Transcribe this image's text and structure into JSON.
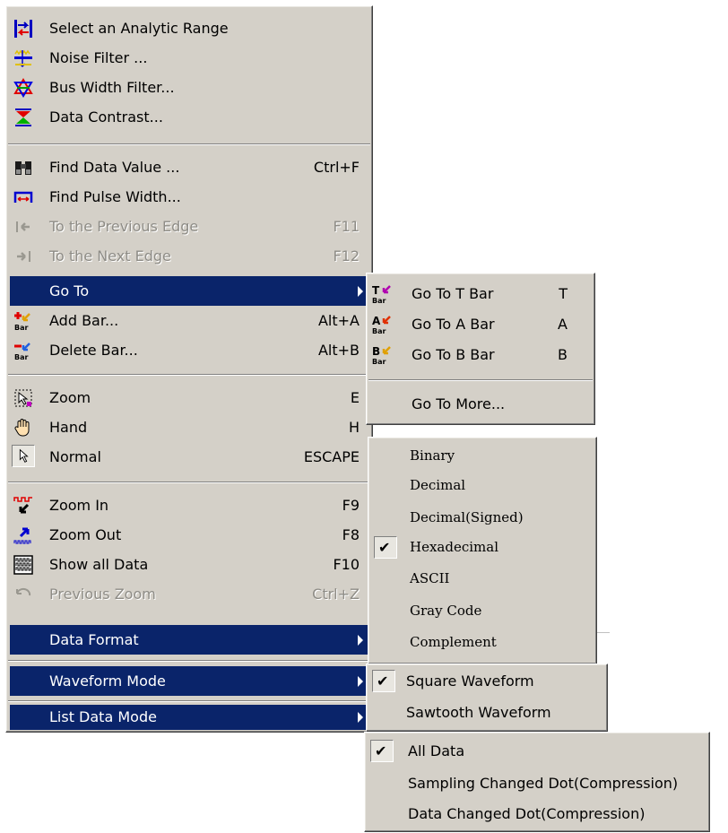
{
  "main_menu": {
    "items": [
      {
        "label": "Select an Analytic Range",
        "shortcut": "",
        "icon": "analytic-range-icon"
      },
      {
        "label": "Noise Filter ...",
        "shortcut": "",
        "icon": "noise-filter-icon"
      },
      {
        "label": "Bus Width Filter...",
        "shortcut": "",
        "icon": "bus-width-filter-icon"
      },
      {
        "label": "Data Contrast...",
        "shortcut": "",
        "icon": "data-contrast-icon"
      },
      {
        "label": "Find Data Value ...",
        "shortcut": "Ctrl+F",
        "icon": "binoculars-icon"
      },
      {
        "label": "Find Pulse Width...",
        "shortcut": "",
        "icon": "pulse-width-icon"
      },
      {
        "label": "To the Previous Edge",
        "shortcut": "F11",
        "icon": "previous-edge-icon",
        "disabled": true
      },
      {
        "label": "To the Next Edge",
        "shortcut": "F12",
        "icon": "next-edge-icon",
        "disabled": true
      },
      {
        "label": "Go To",
        "shortcut": "",
        "submenu": true
      },
      {
        "label": "Add Bar...",
        "shortcut": "Alt+A",
        "icon": "add-bar-icon"
      },
      {
        "label": "Delete Bar...",
        "shortcut": "Alt+B",
        "icon": "delete-bar-icon"
      },
      {
        "label": "Zoom",
        "shortcut": "E",
        "icon": "zoom-select-icon"
      },
      {
        "label": "Hand",
        "shortcut": "H",
        "icon": "hand-icon"
      },
      {
        "label": "Normal",
        "shortcut": "ESCAPE",
        "icon": "arrow-cursor-icon"
      },
      {
        "label": "Zoom In",
        "shortcut": "F9",
        "icon": "zoom-in-icon"
      },
      {
        "label": "Zoom Out",
        "shortcut": "F8",
        "icon": "zoom-out-icon"
      },
      {
        "label": "Show all Data",
        "shortcut": "F10",
        "icon": "show-all-data-icon"
      },
      {
        "label": "Previous Zoom",
        "shortcut": "Ctrl+Z",
        "icon": "undo-icon",
        "disabled": true
      },
      {
        "label": "Data Format",
        "shortcut": "",
        "submenu": true
      },
      {
        "label": "Waveform Mode",
        "shortcut": "",
        "submenu": true
      },
      {
        "label": "List Data Mode",
        "shortcut": "",
        "submenu": true
      }
    ]
  },
  "goto_menu": {
    "items": [
      {
        "label": "Go To T Bar",
        "shortcut": "T",
        "icon": "t-bar-icon"
      },
      {
        "label": "Go To A Bar",
        "shortcut": "A",
        "icon": "a-bar-icon"
      },
      {
        "label": "Go To B Bar",
        "shortcut": "B",
        "icon": "b-bar-icon"
      },
      {
        "label": "Go To More...",
        "shortcut": ""
      }
    ],
    "icon_letters": [
      "T",
      "A",
      "B"
    ],
    "icon_sub": "Bar"
  },
  "data_format_menu": {
    "items": [
      {
        "label": "Binary"
      },
      {
        "label": "Decimal"
      },
      {
        "label": "Decimal(Signed)"
      },
      {
        "label": "Hexadecimal",
        "checked": true
      },
      {
        "label": "ASCII"
      },
      {
        "label": "Gray Code"
      },
      {
        "label": "Complement"
      }
    ]
  },
  "waveform_menu": {
    "items": [
      {
        "label": "Square Waveform",
        "checked": true
      },
      {
        "label": "Sawtooth Waveform"
      }
    ]
  },
  "list_data_menu": {
    "items": [
      {
        "label": "All Data",
        "checked": true
      },
      {
        "label": "Sampling Changed Dot(Compression)"
      },
      {
        "label": "Data Changed Dot(Compression)"
      }
    ]
  },
  "check_mark": "✔",
  "colors": {
    "menu_bg": "#d4d0c8",
    "highlight": "#0a246a"
  }
}
